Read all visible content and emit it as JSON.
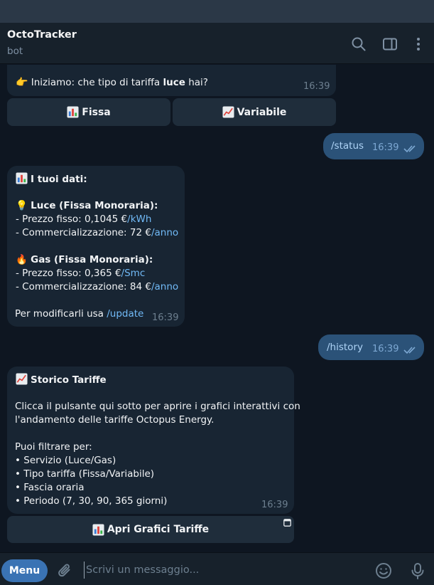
{
  "header": {
    "title": "OctoTracker",
    "subtitle": "bot"
  },
  "messages": {
    "m1": {
      "text_pre": "Iniziamo: che tipo di tariffa",
      "text_bold": "luce",
      "text_post": "hai?",
      "time": "16:39",
      "buttons": [
        "Fissa",
        "Variabile"
      ]
    },
    "m2": {
      "text": "/status",
      "time": "16:39"
    },
    "m3": {
      "heading": "I tuoi dati:",
      "luce_title": "Luce (Fissa Monoraria):",
      "luce_price_pre": "- Prezzo fisso: 0,1045 €",
      "luce_price_link": "/kWh",
      "luce_comm_pre": "- Commercializzazione: 72 €",
      "luce_comm_link": "/anno",
      "gas_title": "Gas (Fissa Monoraria):",
      "gas_price_pre": "- Prezzo fisso: 0,365 €",
      "gas_price_link": "/Smc",
      "gas_comm_pre": "- Commercializzazione: 84 €",
      "gas_comm_link": "/anno",
      "footer_pre": "Per modificarli usa",
      "footer_link": "/update",
      "time": "16:39"
    },
    "m4": {
      "text": "/history",
      "time": "16:39"
    },
    "m5": {
      "heading": "Storico Tariffe",
      "line1": "Clicca il pulsante qui sotto per aprire i grafici interattivi con",
      "line2": "l'andamento delle tariffe Octopus Energy.",
      "filter_title": "Puoi filtrare per:",
      "filters": [
        "• Servizio (Luce/Gas)",
        "• Tipo tariffa (Fissa/Variabile)",
        "• Fascia oraria",
        "• Periodo (7, 30, 90, 365 giorni)"
      ],
      "time": "16:39",
      "button": "Apri Grafici Tariffe"
    }
  },
  "composer": {
    "menu_label": "Menu",
    "placeholder": "Scrivi un messaggio..."
  },
  "colors": {
    "background": "#0e1621",
    "incoming_bubble": "#182533",
    "outgoing_bubble": "#2b5278",
    "link": "#71baf7",
    "menu_button": "#3a73b4"
  },
  "icons": [
    "search-icon",
    "sidebar-toggle-icon",
    "more-vertical-icon",
    "attach-icon",
    "emoji-icon",
    "microphone-icon",
    "bar-chart-emoji",
    "trend-chart-emoji",
    "bulb-emoji",
    "fire-emoji",
    "pointing-hand-emoji",
    "open-app-icon"
  ]
}
